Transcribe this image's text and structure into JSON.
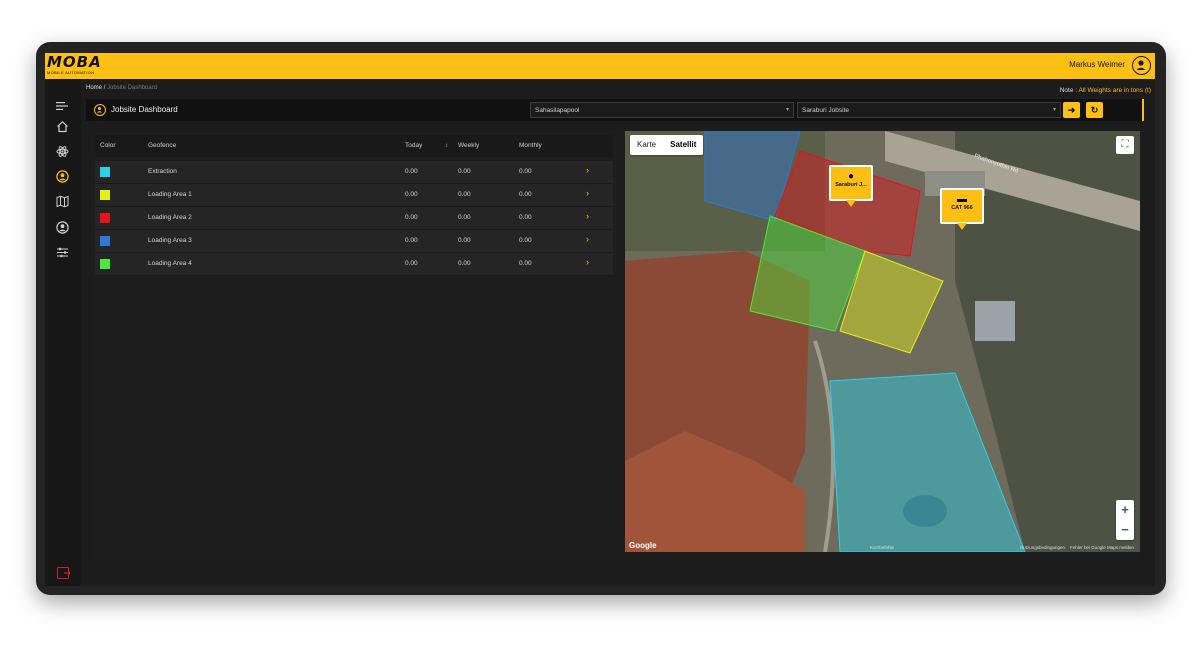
{
  "header": {
    "logo": "MOBA",
    "logo_sub": "MOBILE AUTOMATION",
    "user_name": "Markus Weimer"
  },
  "sidebar": {
    "items": [
      {
        "icon": "menu-icon"
      },
      {
        "icon": "home-icon"
      },
      {
        "icon": "atom-icon"
      },
      {
        "icon": "user-circle-icon"
      },
      {
        "icon": "map-icon"
      },
      {
        "icon": "account-icon"
      },
      {
        "icon": "sliders-icon"
      }
    ],
    "logout_icon": "logout-icon"
  },
  "breadcrumb": {
    "home": "Home",
    "separator": "/",
    "current": "Jobsite Dashboard"
  },
  "note": {
    "label": "Note :",
    "text": "All Weights are in tons (t)"
  },
  "title_bar": {
    "title": "Jobsite Dashboard",
    "company_select": "Sahasilapapool",
    "jobsite_select": "Saraburi Jobsite"
  },
  "table": {
    "headers": {
      "color": "Color",
      "geofence": "Geofence",
      "today": "Today",
      "weekly": "Weekly",
      "monthly": "Monthly"
    },
    "rows": [
      {
        "color": "#29d3e8",
        "geofence": "Extraction",
        "today": "0.00",
        "weekly": "0.00",
        "monthly": "0.00"
      },
      {
        "color": "#e4f016",
        "geofence": "Loading Area 1",
        "today": "0.00",
        "weekly": "0.00",
        "monthly": "0.00"
      },
      {
        "color": "#e3141b",
        "geofence": "Loading Area 2",
        "today": "0.00",
        "weekly": "0.00",
        "monthly": "0.00"
      },
      {
        "color": "#2f78d6",
        "geofence": "Loading Area 3",
        "today": "0.00",
        "weekly": "0.00",
        "monthly": "0.00"
      },
      {
        "color": "#4ee638",
        "geofence": "Loading Area 4",
        "today": "0.00",
        "weekly": "0.00",
        "monthly": "0.00"
      }
    ]
  },
  "map": {
    "tabs": [
      "Karte",
      "Satellit"
    ],
    "active_tab": "Satellit",
    "markers": [
      {
        "label": "Saraburi J..."
      },
      {
        "label": "CAT 966"
      }
    ],
    "road_label": "Phahonyothin Rd",
    "footer_shortcuts": "Kurzbefehle",
    "footer_terms": "Nutzungsbedingungen",
    "footer_report": "Fehler bei Google Maps melden",
    "google": "Google"
  },
  "colors": {
    "accent": "#fcbf14",
    "background": "#1c1c1c"
  }
}
